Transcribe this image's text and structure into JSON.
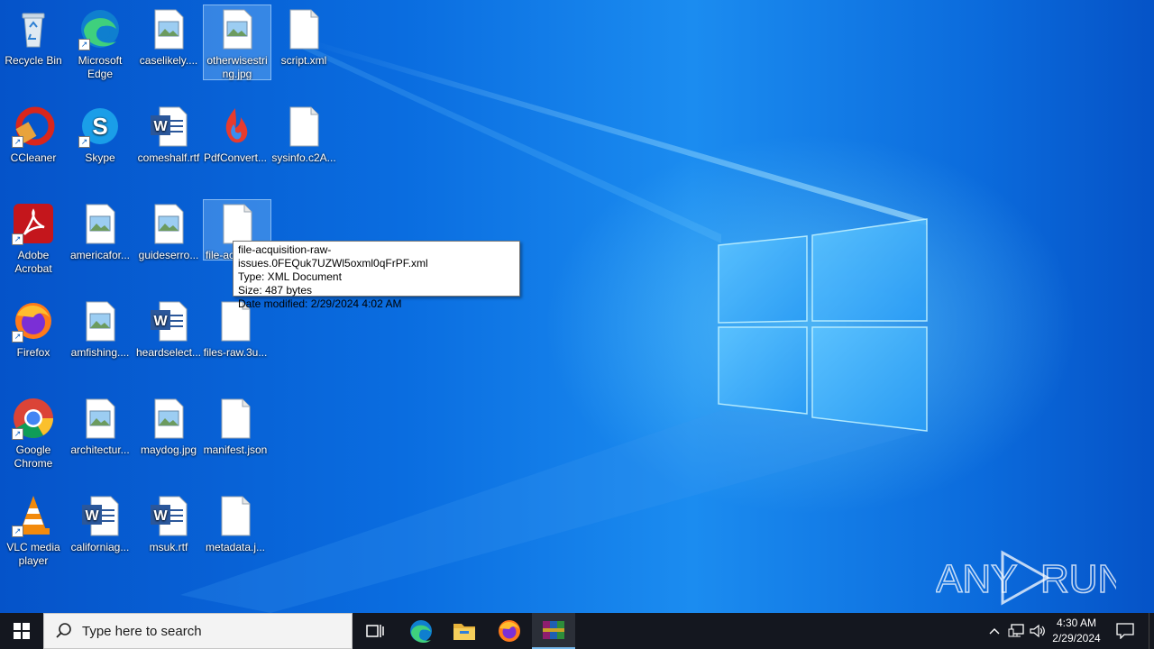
{
  "desktop": {
    "icons": [
      {
        "label": "Recycle Bin"
      },
      {
        "label": "Microsoft Edge"
      },
      {
        "label": "caselikely...."
      },
      {
        "label": "otherwisestring.jpg"
      },
      {
        "label": "script.xml"
      },
      {
        "label": "CCleaner"
      },
      {
        "label": "Skype"
      },
      {
        "label": "comeshalf.rtf"
      },
      {
        "label": "PdfConvert..."
      },
      {
        "label": "sysinfo.c2A..."
      },
      {
        "label": "Adobe Acrobat"
      },
      {
        "label": "americafor..."
      },
      {
        "label": "guideserro..."
      },
      {
        "label": "file-ac"
      },
      {
        "label": "Firefox"
      },
      {
        "label": "amfishing...."
      },
      {
        "label": "heardselect..."
      },
      {
        "label": "files-raw.3u..."
      },
      {
        "label": "Google Chrome"
      },
      {
        "label": "architectur..."
      },
      {
        "label": "maydog.jpg"
      },
      {
        "label": "manifest.json"
      },
      {
        "label": "VLC media player"
      },
      {
        "label": "californiag..."
      },
      {
        "label": "msuk.rtf"
      },
      {
        "label": "metadata.j..."
      }
    ]
  },
  "tooltip": {
    "name": "file-acquisition-raw-issues.0FEQuk7UZWl5oxml0qFrPF.xml",
    "type": "Type: XML Document",
    "size": "Size: 487 bytes",
    "modified": "Date modified: 2/29/2024 4:02 AM"
  },
  "taskbar": {
    "search_placeholder": "Type here to search",
    "time": "4:30 AM",
    "date": "2/29/2024"
  },
  "watermark": {
    "left": "ANY",
    "right": "RUN"
  },
  "colors": {
    "taskbar": "#14171f",
    "accent": "#0a6de0",
    "tooltip_border": "#767676"
  }
}
